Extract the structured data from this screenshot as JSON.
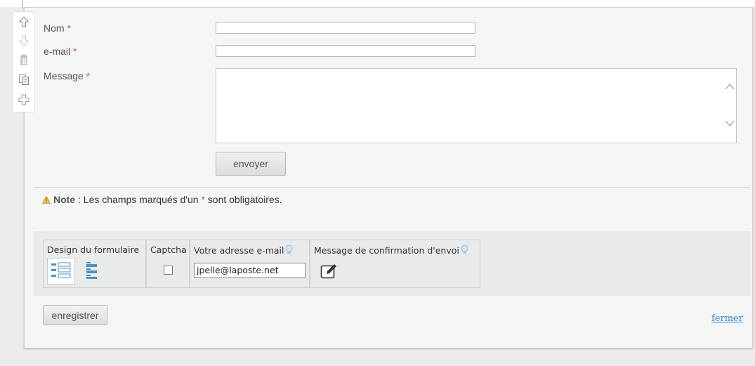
{
  "form": {
    "name_label": "Nom",
    "email_label": "e-mail",
    "message_label": "Message",
    "required_mark": "*",
    "submit_label": "envoyer"
  },
  "note": {
    "title": "Note",
    "text_before": " : Les champs marqués d'un ",
    "required_mark": "*",
    "text_after": " sont obligatoires."
  },
  "config": {
    "design_label": "Design du formulaire",
    "captcha_label": "Captcha",
    "email_label": "Votre adresse e-mail",
    "email_value": "jpelle@laposte.net",
    "confirmation_label": "Message de confirmation d'envoi"
  },
  "footer": {
    "save_label": "enregistrer",
    "close_label": "fermer"
  },
  "toolbar_icons": [
    "arrow-up-icon",
    "arrow-down-icon",
    "trash-icon",
    "copy-icon",
    "plus-icon"
  ],
  "colors": {
    "required": "#d9534f",
    "link": "#3a86c8",
    "warning": "#e8a317"
  }
}
